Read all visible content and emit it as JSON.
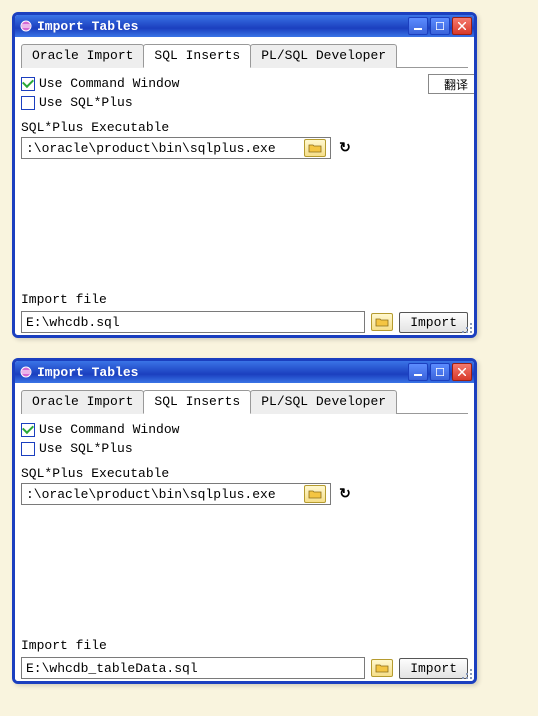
{
  "windows": [
    {
      "title": "Import Tables",
      "tabs": [
        "Oracle Import",
        "SQL Inserts",
        "PL/SQL Developer"
      ],
      "active_tab": "SQL Inserts",
      "use_command_window_label": "Use Command Window",
      "use_command_window_checked": true,
      "use_sqlplus_label": "Use SQL*Plus",
      "use_sqlplus_checked": false,
      "sqlplus_exec_label": "SQL*Plus Executable",
      "sqlplus_exec_value": ":\\oracle\\product\\bin\\sqlplus.exe",
      "import_file_label": "Import file",
      "import_file_value": "E:\\whcdb.sql",
      "import_button": "Import",
      "translate_button": "翻译"
    },
    {
      "title": "Import Tables",
      "tabs": [
        "Oracle Import",
        "SQL Inserts",
        "PL/SQL Developer"
      ],
      "active_tab": "SQL Inserts",
      "use_command_window_label": "Use Command Window",
      "use_command_window_checked": true,
      "use_sqlplus_label": "Use SQL*Plus",
      "use_sqlplus_checked": false,
      "sqlplus_exec_label": "SQL*Plus Executable",
      "sqlplus_exec_value": ":\\oracle\\product\\bin\\sqlplus.exe",
      "import_file_label": "Import file",
      "import_file_value": "E:\\whcdb_tableData.sql",
      "import_button": "Import"
    }
  ]
}
